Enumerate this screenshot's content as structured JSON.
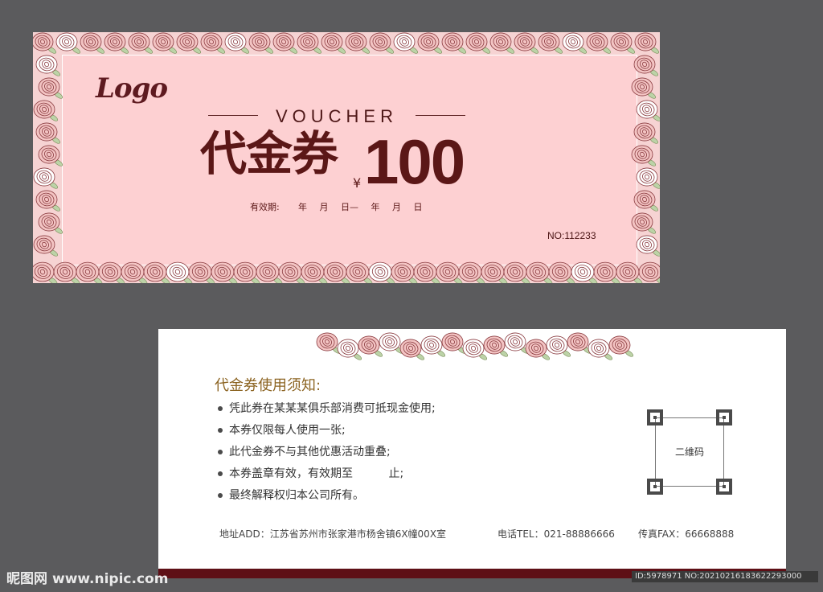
{
  "front": {
    "logo_text": "Logo",
    "voucher_word": "VOUCHER",
    "title_cn": "代金券",
    "currency_symbol": "¥",
    "amount": "100",
    "validity_label": "有效期:",
    "validity_dates": "年 月 日— 年 月 日",
    "serial_number": "NO:112233"
  },
  "back": {
    "rules_title": "代金券使用须知:",
    "rules": [
      "凭此券在某某某俱乐部消费可抵现金使用;",
      "本券仅限每人使用一张;",
      "此代金券不与其他优惠活动重叠;",
      "本券盖章有效，有效期至          止;",
      "最终解释权归本公司所有。"
    ],
    "qr_label": "二维码",
    "address": "地址ADD：江苏省苏州市张家港市杨舍镇6X幢00X室",
    "tel": "电话TEL：021-88886666",
    "fax": "传真FAX：66668888"
  },
  "watermark": {
    "brand": "昵图网",
    "url": "www.nipic.com",
    "id_text": "ID:5978971 NO:20210216183622293000"
  },
  "colors": {
    "background": "#5b5b5d",
    "front_pink": "#fdd0d2",
    "maroon": "#5b1717",
    "gold_title": "#8c6422",
    "bottom_bar": "#5e0f16"
  },
  "icons": [
    "rose-pattern-icon",
    "qr-code-icon"
  ]
}
